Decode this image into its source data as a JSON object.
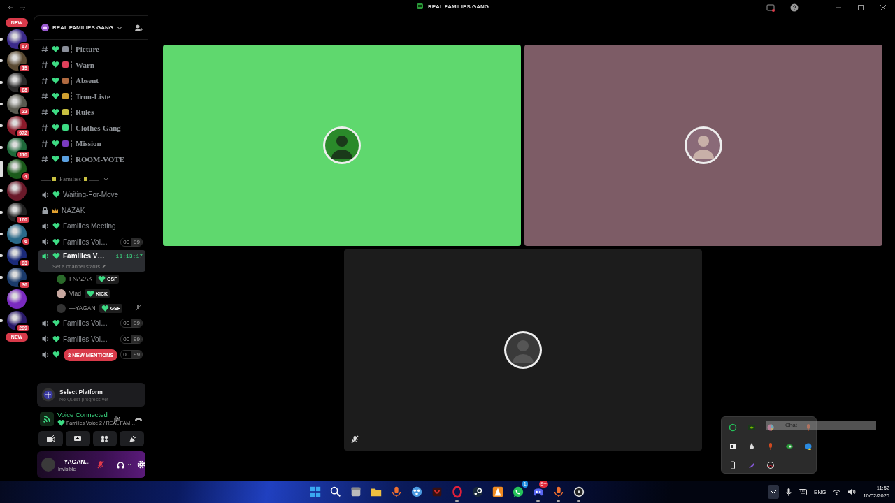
{
  "window": {
    "title": "REAL FAMILIES GANG"
  },
  "servers": [
    {
      "kind": "new",
      "badge": "NEW"
    },
    {
      "kind": "server",
      "badge": "47",
      "selected": false,
      "unread": true
    },
    {
      "kind": "server",
      "badge": "15",
      "selected": false,
      "unread": true
    },
    {
      "kind": "server",
      "badge": "68",
      "selected": false,
      "unread": true
    },
    {
      "kind": "server",
      "badge": "22",
      "selected": false,
      "unread": true
    },
    {
      "kind": "server",
      "badge": "972",
      "selected": false,
      "unread": true
    },
    {
      "kind": "server",
      "badge": "110",
      "selected": false,
      "unread": true
    },
    {
      "kind": "server",
      "badge": "4",
      "selected": true,
      "unread": false
    },
    {
      "kind": "server",
      "selected": false,
      "unread": true
    },
    {
      "kind": "server",
      "badge": "160",
      "selected": false,
      "unread": true
    },
    {
      "kind": "server",
      "badge": "6",
      "selected": false,
      "unread": true
    },
    {
      "kind": "server",
      "badge": "93",
      "selected": false,
      "unread": true
    },
    {
      "kind": "server",
      "badge": "36",
      "selected": false,
      "unread": true
    },
    {
      "kind": "server",
      "selected": false,
      "unread": false
    },
    {
      "kind": "server",
      "badge": "299",
      "selected": false,
      "unread": true
    },
    {
      "kind": "new",
      "badge": "NEW"
    }
  ],
  "sidebar": {
    "server_name": "REAL FAMILIES GANG",
    "channels": [
      {
        "kind": "text",
        "name": "Picture",
        "color": "#8a8f9a",
        "selected": false
      },
      {
        "kind": "text",
        "name": "Warn",
        "color": "#e0405a",
        "selected": false
      },
      {
        "kind": "text",
        "name": "Absent",
        "color": "#b06a40",
        "selected": false
      },
      {
        "kind": "text",
        "name": "Tron-Liste",
        "color": "#d0a030",
        "selected": false
      },
      {
        "kind": "text",
        "name": "Rules",
        "color": "#c8c040",
        "selected": false
      },
      {
        "kind": "text",
        "name": "Clothes-Gang",
        "color": "#3ddc84",
        "selected": false
      },
      {
        "kind": "text",
        "name": "Mission",
        "color": "#7a3ac0",
        "selected": false
      },
      {
        "kind": "text",
        "name": "ROOM-VOTE",
        "color": "#5aa0e0",
        "selected": false
      },
      {
        "kind": "category",
        "name": "Families"
      },
      {
        "kind": "voice",
        "name": "Waiting-For-Move",
        "selected": false
      },
      {
        "kind": "locked",
        "name": "NAZAK",
        "selected": false
      },
      {
        "kind": "voice",
        "name": "Families Meeting",
        "selected": false
      },
      {
        "kind": "voice",
        "name": "Families Voi…",
        "users": "00",
        "limit": "99",
        "selected": false
      },
      {
        "kind": "voice",
        "name": "Families V…",
        "selected": true,
        "timer": "11:13:17",
        "status": "Set a channel status",
        "members": [
          {
            "name": "I NAZAK",
            "tag": "GSF",
            "muted": false
          },
          {
            "name": "Vlad",
            "tag": "KICK",
            "muted": false
          },
          {
            "name": "—YAGAN",
            "tag": "GSF",
            "muted": true
          }
        ]
      },
      {
        "kind": "voice",
        "name": "Families Voi…",
        "users": "00",
        "limit": "99",
        "selected": false
      },
      {
        "kind": "voice",
        "name": "Families Voi…",
        "users": "00",
        "limit": "99",
        "selected": false
      },
      {
        "kind": "voice",
        "users": "00",
        "limit": "99",
        "selected": false,
        "mentions": "2 NEW MENTIONS"
      }
    ]
  },
  "quest": {
    "title": "Select Platform",
    "subtitle": "No Quest progress yet"
  },
  "voice_panel": {
    "status": "Voice Connected",
    "channel": "Families Voice 2 / REAL FAM…"
  },
  "user": {
    "name": "—YAGAN...",
    "status": "Invisible",
    "mic_muted": true
  },
  "tiles": [
    {
      "color": "#5fd86e",
      "muted": false
    },
    {
      "color": "#7d5c66",
      "muted": false
    },
    {
      "color": "#1c1c1c",
      "muted": true
    }
  ],
  "tray_popup": {
    "tooltip": "Chat",
    "icons": [
      {
        "kind": "chat"
      },
      {
        "kind": "eye"
      },
      {
        "kind": "wheel"
      },
      {
        "kind": "mic"
      },
      {
        "kind": "tile"
      },
      {
        "kind": "drop"
      },
      {
        "kind": "mic"
      },
      {
        "kind": "swirl"
      },
      {
        "kind": "globe"
      },
      {
        "kind": "drive"
      },
      {
        "kind": "feather"
      },
      {
        "kind": "disc"
      }
    ]
  },
  "taskbar": {
    "apps": [
      {
        "kind": "start",
        "running": false
      },
      {
        "kind": "search",
        "running": false
      },
      {
        "kind": "window",
        "running": false
      },
      {
        "kind": "folder",
        "running": false
      },
      {
        "kind": "mic",
        "running": false
      },
      {
        "kind": "orb",
        "running": false
      },
      {
        "kind": "square",
        "running": false
      },
      {
        "kind": "ring",
        "running": true
      },
      {
        "kind": "steam",
        "running": false
      },
      {
        "kind": "triangle",
        "running": false
      },
      {
        "kind": "chat",
        "running": false,
        "badge": "1"
      },
      {
        "kind": "gamepad",
        "running": true,
        "badge": "9+"
      },
      {
        "kind": "mic",
        "running": true
      },
      {
        "kind": "disc",
        "running": true
      }
    ],
    "language": "ENG",
    "time": "11:52",
    "date": "10/02/2026"
  }
}
